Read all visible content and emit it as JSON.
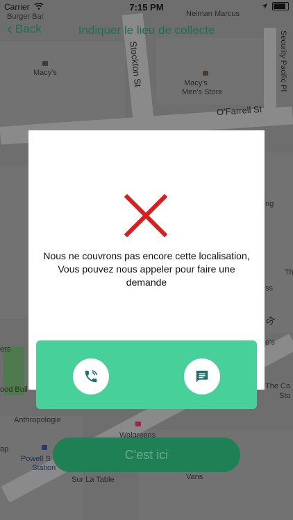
{
  "status_bar": {
    "carrier": "Carrier",
    "time": "7:15 PM"
  },
  "nav": {
    "back_label": "Back",
    "title": "Indiquer le lieu de collecte"
  },
  "map": {
    "labels": {
      "burger_bar": "Burger Bar",
      "neiman_marcus": "Neiman Marcus",
      "stockton_st": "Stockton St",
      "macys": "Macy's",
      "macys_mens_1": "Macy's",
      "macys_mens_2": "Men's Store",
      "security_pacific": "Security Pacific Pl",
      "ofarrell_st": "O'Farrell St",
      "ng": "ng",
      "th": "Th",
      "ss": "ss",
      "st_right": "St",
      "es_right": "e's",
      "ers_left": "ers",
      "ood_buil": "ood Buil",
      "the_co": "The Co",
      "sto": "Sto",
      "anthropologie": "Anthropologie",
      "walgreens": "Walgreens",
      "ap": "ap",
      "powell_1": "Powell S",
      "powell_2": "Station",
      "sur_la_table": "Sur La Table",
      "vans": "Vans"
    }
  },
  "modal": {
    "message": "Nous ne couvrons pas encore cette localisation, Vous pouvez nous appeler pour faire une demande",
    "error_color": "#e01b1b",
    "panel_color": "#48d09b"
  },
  "cta": {
    "label": "C'est ici"
  }
}
